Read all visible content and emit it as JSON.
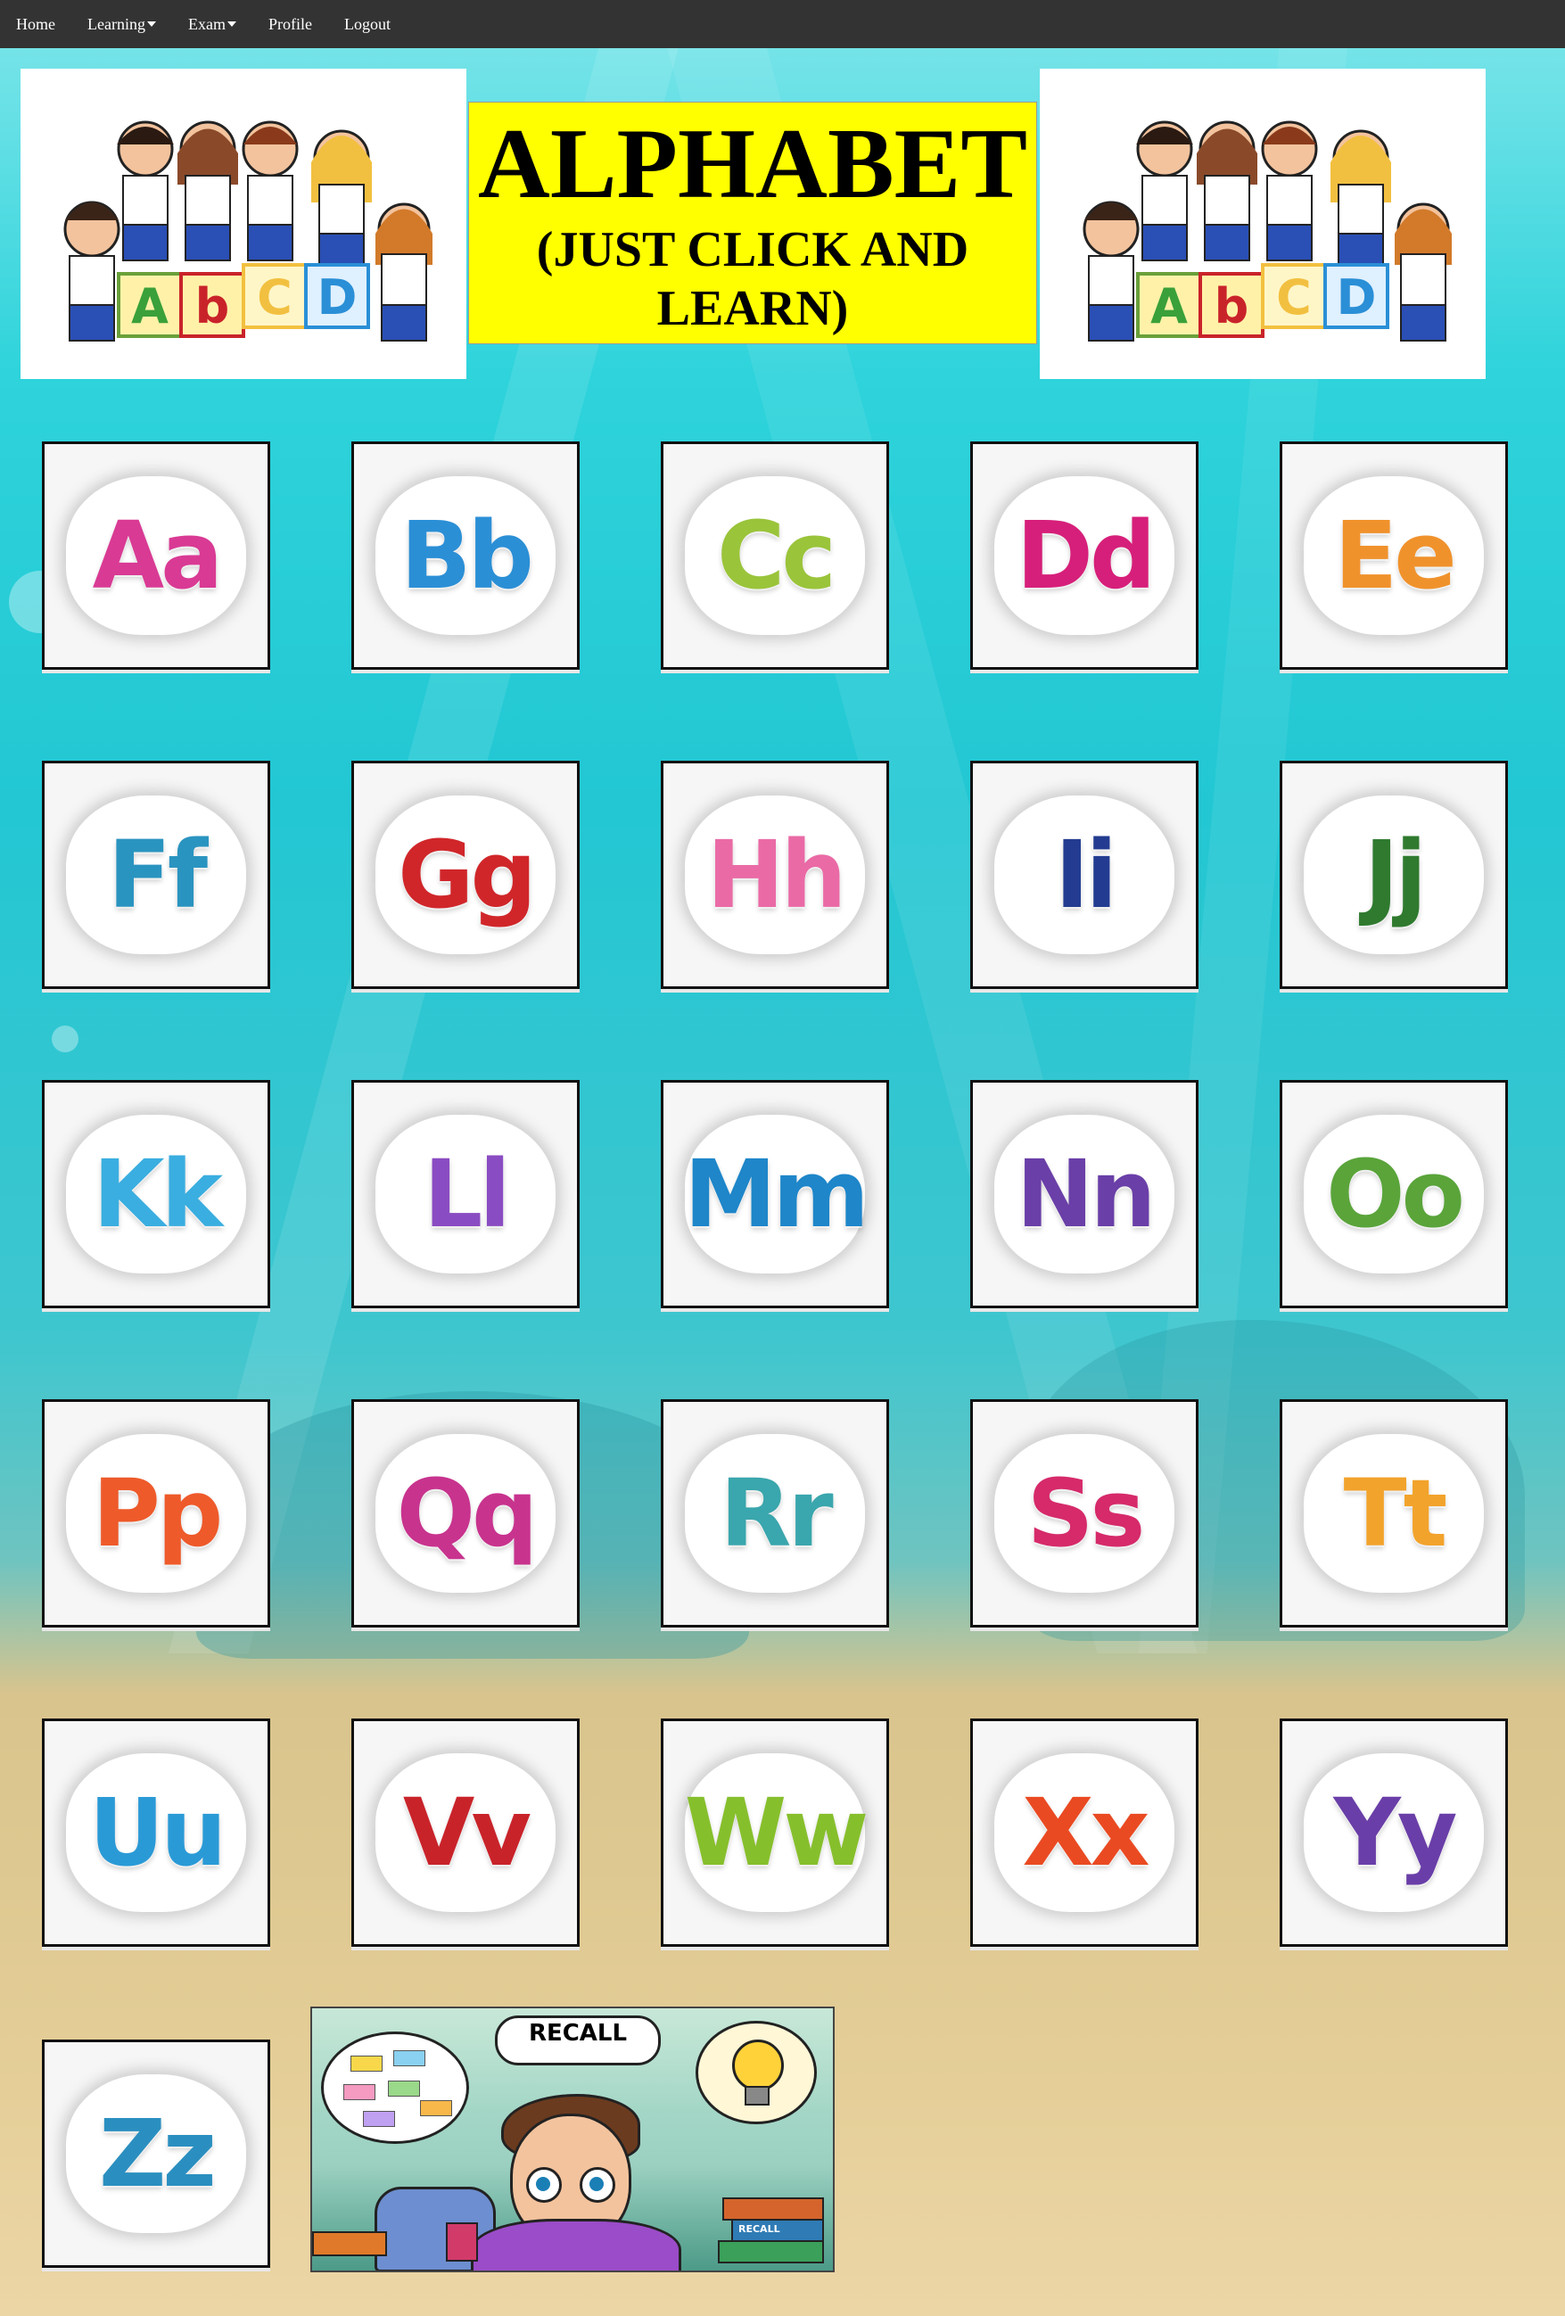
{
  "nav": {
    "items": [
      {
        "label": "Home",
        "dropdown": false
      },
      {
        "label": "Learning",
        "dropdown": true
      },
      {
        "label": "Exam",
        "dropdown": true
      },
      {
        "label": "Profile",
        "dropdown": false
      },
      {
        "label": "Logout",
        "dropdown": false
      }
    ]
  },
  "header": {
    "title": "ALPHABET",
    "subtitle_line1": "(JUST CLICK AND",
    "subtitle_line2": "LEARN)",
    "image_left": "kids-with-abcd-blocks",
    "image_right": "kids-with-abcd-blocks",
    "block_letters": [
      "A",
      "B",
      "b",
      "C",
      "d",
      "D"
    ]
  },
  "letters": [
    {
      "text": "Aa",
      "color": "#d93a94"
    },
    {
      "text": "Bb",
      "color": "#2b8fd6"
    },
    {
      "text": "Cc",
      "color": "#9ac43a"
    },
    {
      "text": "Dd",
      "color": "#d61f7a"
    },
    {
      "text": "Ee",
      "color": "#f0922c"
    },
    {
      "text": "Ff",
      "color": "#2a94c0"
    },
    {
      "text": "Gg",
      "color": "#d0262a"
    },
    {
      "text": "Hh",
      "color": "#ea6aa6"
    },
    {
      "text": "Ii",
      "color": "#233c91"
    },
    {
      "text": "Jj",
      "color": "#2f7a2f"
    },
    {
      "text": "Kk",
      "color": "#3aaee0"
    },
    {
      "text": "Ll",
      "color": "#8a4cc2"
    },
    {
      "text": "Mm",
      "color": "#1e86c9"
    },
    {
      "text": "Nn",
      "color": "#6a3fa8"
    },
    {
      "text": "Oo",
      "color": "#5aa43a"
    },
    {
      "text": "Pp",
      "color": "#ee5a2a"
    },
    {
      "text": "Qq",
      "color": "#c8338e"
    },
    {
      "text": "Rr",
      "color": "#3aa6ad"
    },
    {
      "text": "Ss",
      "color": "#d62a6a"
    },
    {
      "text": "Tt",
      "color": "#f2a32c"
    },
    {
      "text": "Uu",
      "color": "#2a9ad6"
    },
    {
      "text": "Vv",
      "color": "#c9232a"
    },
    {
      "text": "Ww",
      "color": "#86bf2c"
    },
    {
      "text": "Xx",
      "color": "#ea4a22"
    },
    {
      "text": "Yy",
      "color": "#6a3ea8"
    },
    {
      "text": "Zz",
      "color": "#2a8fc0"
    }
  ],
  "recall": {
    "label": "RECALL",
    "book_label": "RECALL"
  },
  "colors": {
    "navbar": "#333333",
    "title_bg": "#ffff00"
  }
}
